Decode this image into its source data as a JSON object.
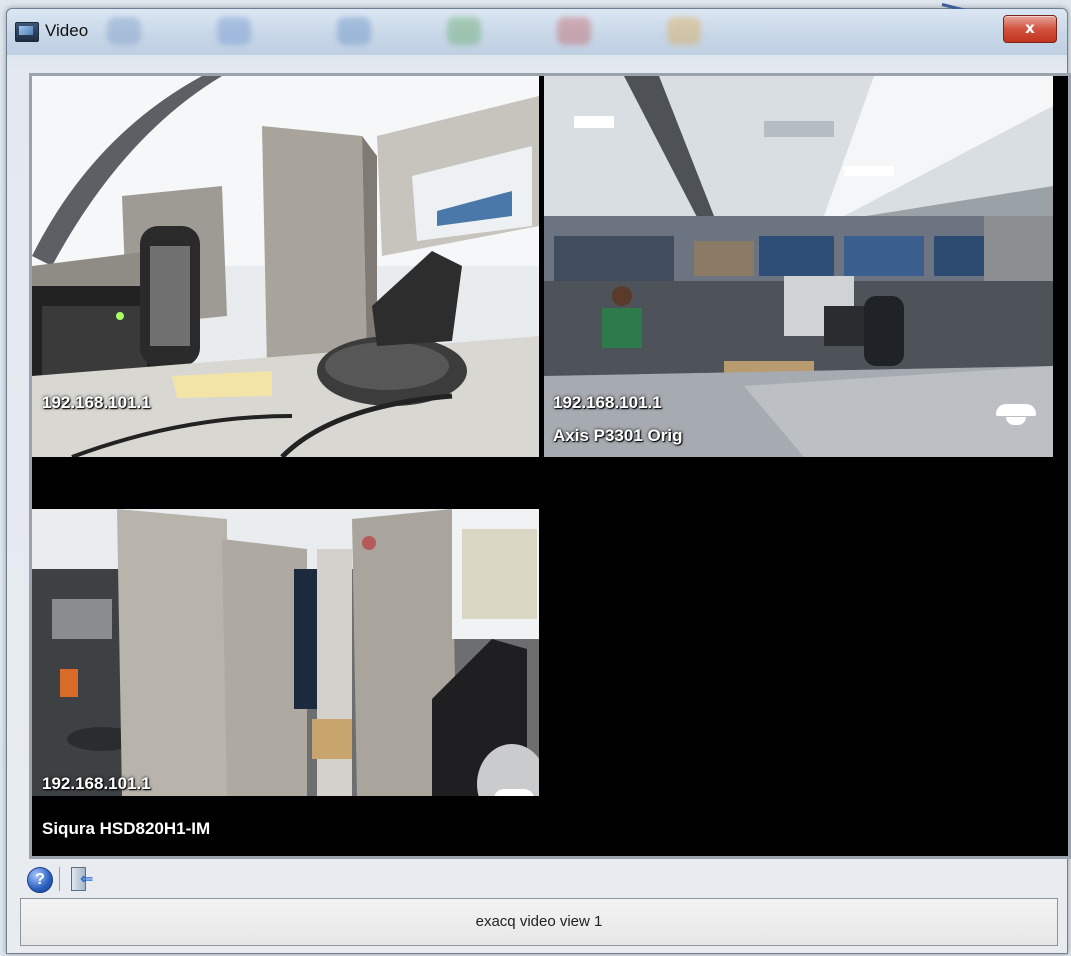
{
  "window": {
    "title": "Video",
    "close_label": "x"
  },
  "tiles": [
    {
      "ip": "192.168.101.1",
      "name": ""
    },
    {
      "ip": "192.168.101.1",
      "name": "Axis P3301 Orig",
      "ptz_icon": "dome-camera-icon"
    },
    {
      "ip": "192.168.101.1",
      "name": "Siqura HSD820H1-IM",
      "ptz_icon": "dome-camera-icon"
    }
  ],
  "toolbar": {
    "help_icon": "help-icon",
    "help_glyph": "?",
    "exit_icon": "exit-icon",
    "exit_glyph": "⇐"
  },
  "status": {
    "text": "exacq video view 1"
  },
  "colors": {
    "close_button": "#c8412c",
    "video_background": "#000000",
    "frame": "#cfdbe8"
  }
}
